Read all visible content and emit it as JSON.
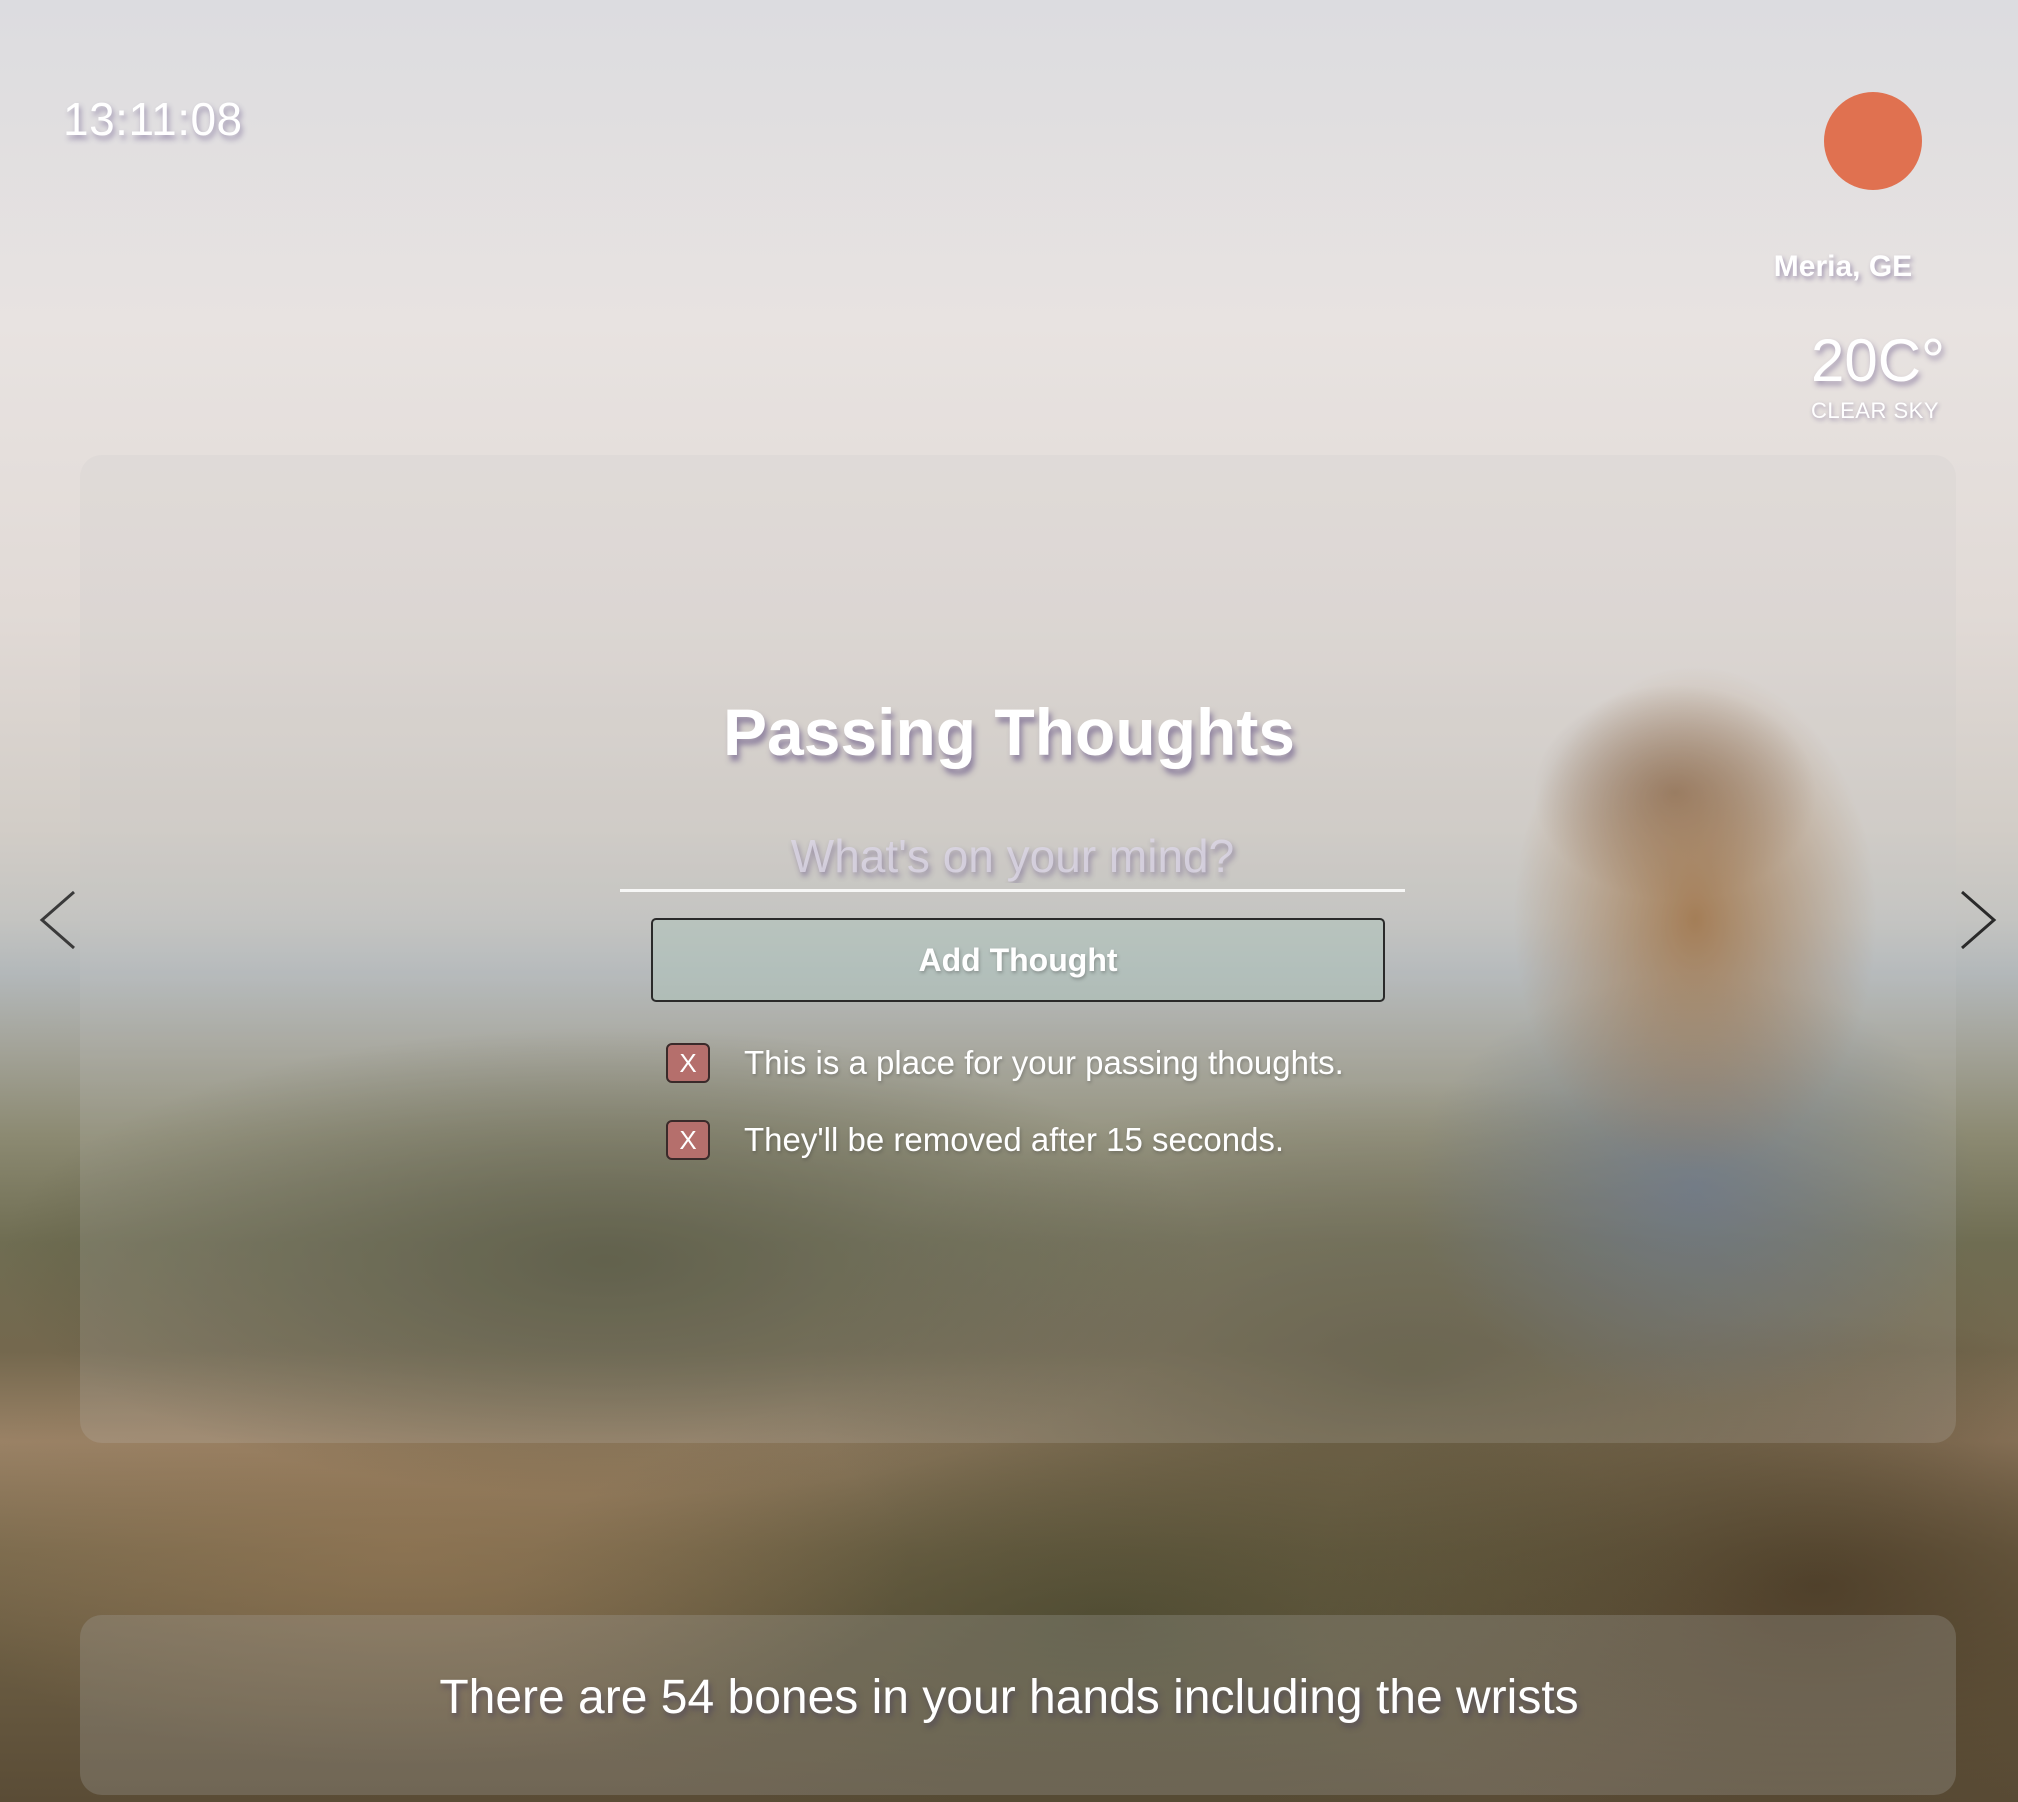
{
  "clock": {
    "time": "13:11:08"
  },
  "weather": {
    "icon": "sun-icon",
    "icon_color": "#e07150",
    "location": "Meria, GE",
    "temperature": "20C°",
    "condition": "CLEAR SKY"
  },
  "thoughts": {
    "title": "Passing Thoughts",
    "input_placeholder": "What's on your mind?",
    "input_value": "",
    "add_button_label": "Add Thought",
    "items": [
      {
        "remove_label": "X",
        "text": "This is a place for your passing thoughts."
      },
      {
        "remove_label": "X",
        "text": "They'll be removed after 15 seconds."
      }
    ]
  },
  "navigation": {
    "prev_icon": "chevron-left-icon",
    "next_icon": "chevron-right-icon"
  },
  "fact": {
    "text": "There are 54 bones in your hands including the wrists"
  }
}
